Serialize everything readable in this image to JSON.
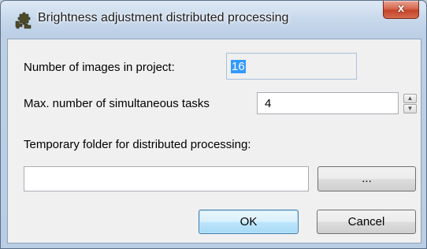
{
  "window": {
    "title": "Brightness adjustment distributed processing",
    "close_label": "x",
    "app_icon": "puzzle-piece-icon",
    "close_icon": "close-icon"
  },
  "form": {
    "images_label": "Number of images in project:",
    "images_value": "16",
    "tasks_label": "Max. number of simultaneous tasks",
    "tasks_value": "4",
    "spin_up": "▲",
    "spin_down": "▼",
    "folder_label": "Temporary folder for distributed processing:",
    "folder_value": "",
    "browse_label": "..."
  },
  "buttons": {
    "ok": "OK",
    "cancel": "Cancel"
  },
  "colors": {
    "accent": "#3399ff",
    "close": "#c5442a"
  }
}
